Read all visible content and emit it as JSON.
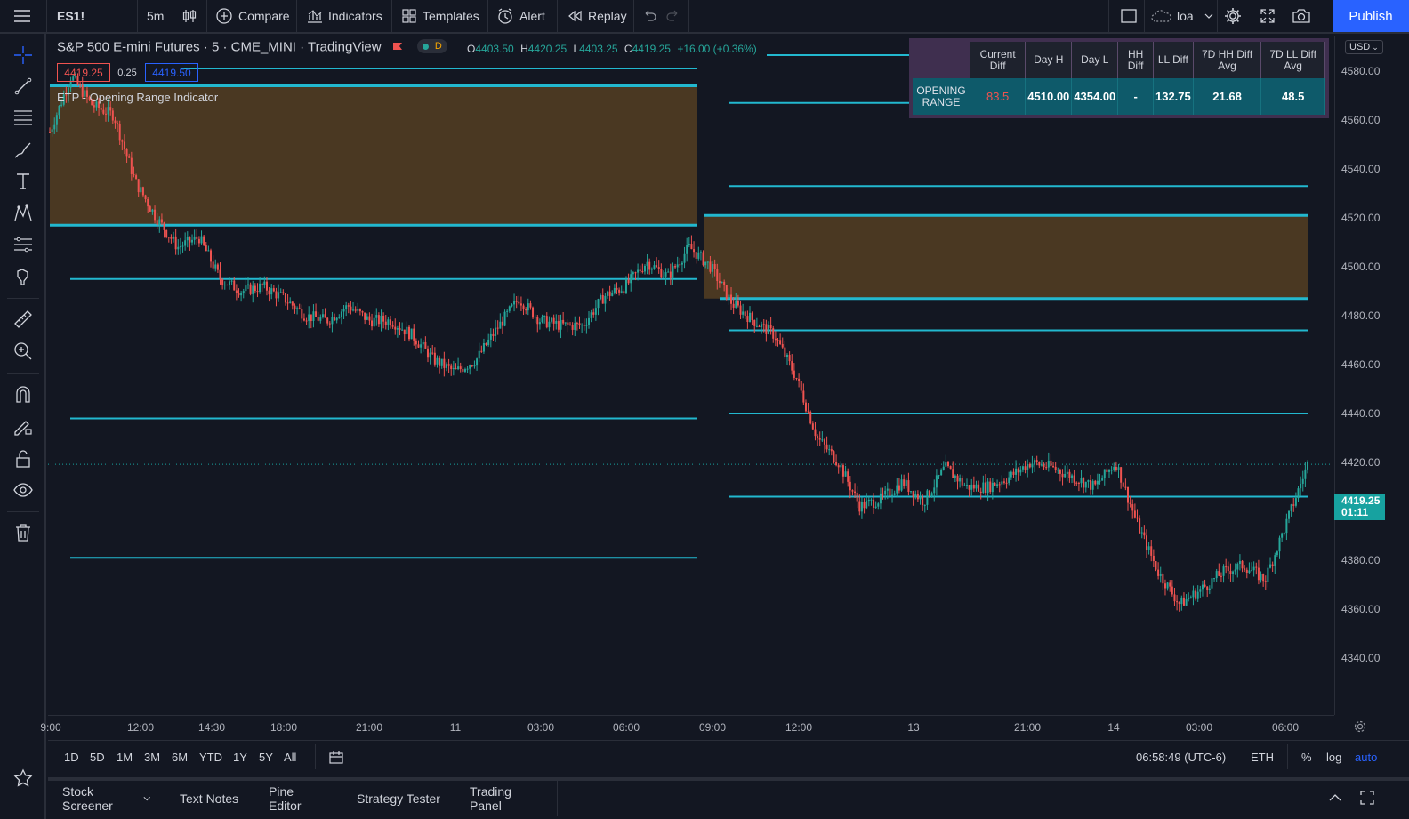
{
  "topbar": {
    "symbol": "ES1!",
    "interval": "5m",
    "compare": "Compare",
    "indicators": "Indicators",
    "templates": "Templates",
    "alert": "Alert",
    "replay": "Replay",
    "layout_name": "loa",
    "publish": "Publish"
  },
  "legend": {
    "title": "S&P 500 E-mini Futures · 5 · CME_MINI · TradingView",
    "badge": "D",
    "open_label": "O",
    "open": "4403.50",
    "high_label": "H",
    "high": "4420.25",
    "low_label": "L",
    "low": "4403.25",
    "close_label": "C",
    "close": "4419.25",
    "change": "+16.00 (+0.36%)",
    "bid": "4419.25",
    "spread": "0.25",
    "ask": "4419.50",
    "indicator_name": "ETP - Opening Range Indicator"
  },
  "stats_table": {
    "headers": [
      "Current Diff",
      "Day H",
      "Day L",
      "HH Diff",
      "LL Diff",
      "7D HH Diff Avg",
      "7D LL Diff Avg"
    ],
    "row_label": "OPENING RANGE",
    "values": [
      "83.5",
      "4510.00",
      "4354.00",
      "-",
      "132.75",
      "21.68",
      "48.5"
    ]
  },
  "price_scale": {
    "currency": "USD",
    "ticks": [
      "4580.00",
      "4560.00",
      "4540.00",
      "4520.00",
      "4500.00",
      "4480.00",
      "4460.00",
      "4440.00",
      "4420.00",
      "4400.00",
      "4380.00",
      "4360.00",
      "4340.00"
    ],
    "current_price": "4419.25",
    "countdown": "01:11"
  },
  "time_axis": {
    "ticks": [
      "9:00",
      "12:00",
      "14:30",
      "18:00",
      "21:00",
      "11",
      "03:00",
      "06:00",
      "09:00",
      "12:00",
      "13",
      "21:00",
      "14",
      "03:00",
      "06:00"
    ]
  },
  "range_bar": {
    "ranges": [
      "1D",
      "5D",
      "1M",
      "3M",
      "6M",
      "YTD",
      "1Y",
      "5Y",
      "All"
    ],
    "clock": "06:58:49 (UTC-6)",
    "session": "ETH",
    "percent": "%",
    "log": "log",
    "auto": "auto"
  },
  "bottom_tabs": [
    "Stock Screener",
    "Text Notes",
    "Pine Editor",
    "Strategy Tester",
    "Trading Panel"
  ],
  "colors": {
    "background": "#131722",
    "up": "#26a69a",
    "down": "#ef5350",
    "level_line": "#22b8cf",
    "range_fill": "#4a3822",
    "accent": "#2962ff"
  },
  "chart_data": {
    "type": "candlestick",
    "series": [
      {
        "name": "ES1!",
        "points": [
          [
            "9:00",
            4555
          ],
          [
            "10:00",
            4578
          ],
          [
            "11:00",
            4566
          ],
          [
            "12:00",
            4562
          ],
          [
            "12:30",
            4535
          ],
          [
            "13:00",
            4520
          ],
          [
            "13:30",
            4508
          ],
          [
            "14:00",
            4512
          ],
          [
            "14:30",
            4495
          ],
          [
            "15:00",
            4490
          ],
          [
            "16:00",
            4492
          ],
          [
            "17:00",
            4487
          ],
          [
            "18:00",
            4480
          ],
          [
            "19:00",
            4478
          ],
          [
            "20:00",
            4484
          ],
          [
            "21:00",
            4478
          ],
          [
            "22:00",
            4478
          ],
          [
            "23:00",
            4472
          ],
          [
            "00:00",
            4462
          ],
          [
            "01:00",
            4457
          ],
          [
            "02:00",
            4462
          ],
          [
            "03:00",
            4475
          ],
          [
            "03:30",
            4487
          ],
          [
            "04:00",
            4478
          ],
          [
            "05:00",
            4476
          ],
          [
            "06:00",
            4476
          ],
          [
            "06:30",
            4488
          ],
          [
            "07:00",
            4492
          ],
          [
            "08:00",
            4502
          ],
          [
            "09:00",
            4496
          ],
          [
            "09:30",
            4508
          ],
          [
            "10:00",
            4500
          ],
          [
            "11:00",
            4485
          ],
          [
            "11:30",
            4478
          ],
          [
            "12:00",
            4472
          ],
          [
            "12:10",
            4455
          ],
          [
            "12:20",
            4430
          ],
          [
            "13:00",
            4420
          ],
          [
            "14:00",
            4402
          ],
          [
            "15:00",
            4405
          ],
          [
            "16:00",
            4412
          ],
          [
            "17:00",
            4404
          ],
          [
            "18:00",
            4418
          ],
          [
            "19:00",
            4410
          ],
          [
            "20:00",
            4410
          ],
          [
            "21:00",
            4414
          ],
          [
            "22:00",
            4420
          ],
          [
            "23:00",
            4418
          ],
          [
            "00:00",
            4414
          ],
          [
            "01:00",
            4410
          ],
          [
            "01:30",
            4420
          ],
          [
            "02:00",
            4395
          ],
          [
            "02:30",
            4375
          ],
          [
            "03:00",
            4362
          ],
          [
            "03:30",
            4368
          ],
          [
            "04:00",
            4375
          ],
          [
            "05:00",
            4378
          ],
          [
            "06:00",
            4372
          ],
          [
            "06:30",
            4395
          ],
          [
            "06:58",
            4419.25
          ]
        ]
      }
    ],
    "indicator": "ETP - Opening Range Indicator",
    "opening_ranges": [
      {
        "session": "1",
        "high": 4574,
        "low": 4517
      },
      {
        "session": "2",
        "high": 4521,
        "low": 4487
      }
    ],
    "levels_session_1": [
      4495,
      4438,
      4381
    ],
    "levels_session_2": [
      4567,
      4533,
      4474,
      4440,
      4406
    ],
    "ylim": [
      4330,
      4590
    ]
  }
}
